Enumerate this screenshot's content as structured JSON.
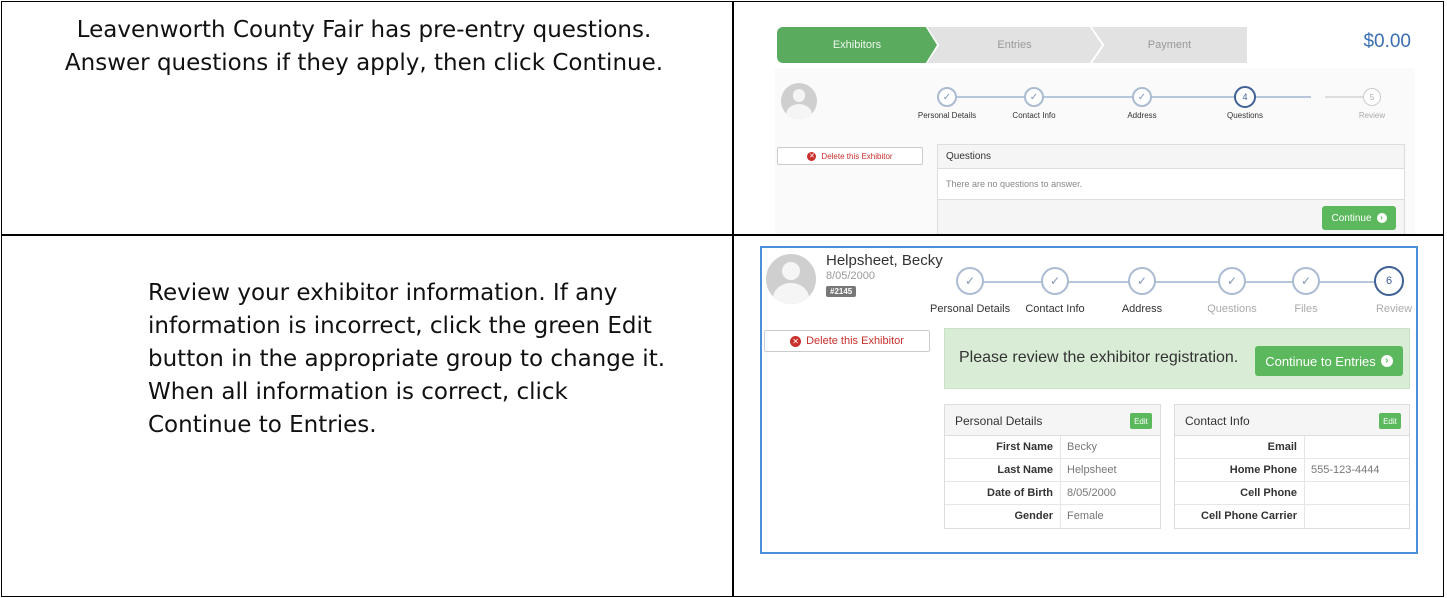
{
  "instructions": {
    "step1_line1": "Leavenworth County Fair has pre-entry questions.",
    "step1_line2": "Answer questions if they apply, then click Continue.",
    "step2_line1": "Review your exhibitor information. If any",
    "step2_line2": "information is incorrect, click the green Edit",
    "step2_line3": "button in the appropriate group to change it.",
    "step2_line4": "When all information is correct, click",
    "step2_line5": "Continue to Entries."
  },
  "screen1": {
    "wizard": {
      "exhibitors": "Exhibitors",
      "entries": "Entries",
      "payment": "Payment",
      "total": "$0.00"
    },
    "steps": [
      {
        "label": "Personal Details",
        "mark": "✓"
      },
      {
        "label": "Contact Info",
        "mark": "✓"
      },
      {
        "label": "Address",
        "mark": "✓"
      },
      {
        "label": "Questions",
        "mark": "4"
      },
      {
        "label": "Review",
        "mark": "5"
      }
    ],
    "delete_label": "Delete this Exhibitor",
    "questions_title": "Questions",
    "no_questions": "There are no questions to answer.",
    "continue_label": "Continue"
  },
  "screen2": {
    "exhibitor": {
      "name": "Helpsheet, Becky",
      "dob": "8/05/2000",
      "id": "#2145"
    },
    "steps": [
      {
        "label": "Personal Details",
        "mark": "✓"
      },
      {
        "label": "Contact Info",
        "mark": "✓"
      },
      {
        "label": "Address",
        "mark": "✓"
      },
      {
        "label": "Questions",
        "mark": "✓"
      },
      {
        "label": "Files",
        "mark": "✓"
      },
      {
        "label": "Review",
        "mark": "6"
      }
    ],
    "delete_label": "Delete this Exhibitor",
    "review_message": "Please review the exhibitor registration.",
    "continue_label": "Continue to Entries",
    "personal": {
      "title": "Personal Details",
      "edit": "Edit",
      "rows": [
        {
          "label": "First Name",
          "value": "Becky"
        },
        {
          "label": "Last Name",
          "value": "Helpsheet"
        },
        {
          "label": "Date of Birth",
          "value": "8/05/2000"
        },
        {
          "label": "Gender",
          "value": "Female"
        }
      ]
    },
    "contact": {
      "title": "Contact Info",
      "edit": "Edit",
      "rows": [
        {
          "label": "Email",
          "value": ""
        },
        {
          "label": "Home Phone",
          "value": "555-123-4444"
        },
        {
          "label": "Cell Phone",
          "value": ""
        },
        {
          "label": "Cell Phone Carrier",
          "value": ""
        }
      ]
    }
  }
}
